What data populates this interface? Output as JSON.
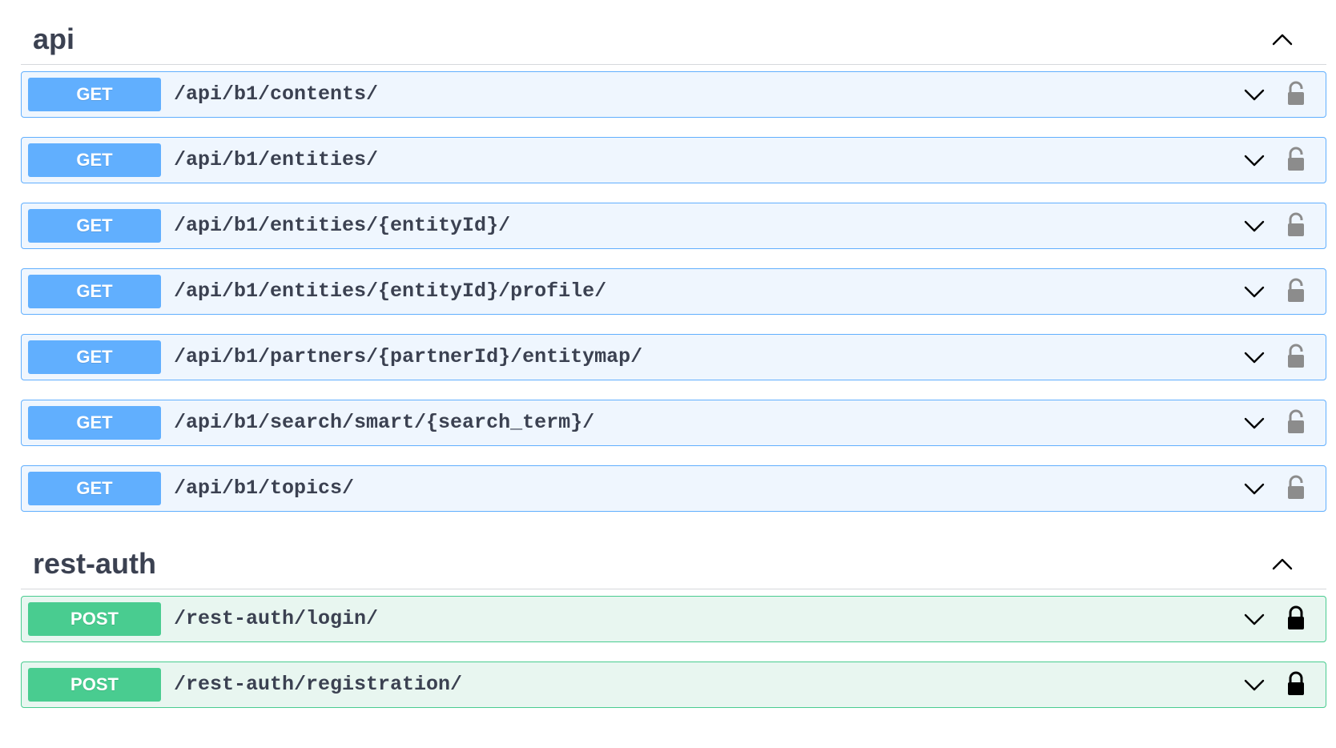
{
  "sections": [
    {
      "title": "api",
      "operations": [
        {
          "method": "GET",
          "path": "/api/b1/contents/",
          "locked": false
        },
        {
          "method": "GET",
          "path": "/api/b1/entities/",
          "locked": false
        },
        {
          "method": "GET",
          "path": "/api/b1/entities/{entityId}/",
          "locked": false
        },
        {
          "method": "GET",
          "path": "/api/b1/entities/{entityId}/profile/",
          "locked": false
        },
        {
          "method": "GET",
          "path": "/api/b1/partners/{partnerId}/entitymap/",
          "locked": false
        },
        {
          "method": "GET",
          "path": "/api/b1/search/smart/{search_term}/",
          "locked": false
        },
        {
          "method": "GET",
          "path": "/api/b1/topics/",
          "locked": false
        }
      ]
    },
    {
      "title": "rest-auth",
      "operations": [
        {
          "method": "POST",
          "path": "/rest-auth/login/",
          "locked": true
        },
        {
          "method": "POST",
          "path": "/rest-auth/registration/",
          "locked": true
        }
      ]
    }
  ],
  "icons": {
    "section_toggle": "chevron-up-icon",
    "operation_toggle": "chevron-down-icon",
    "lock_unlocked": "lock-open-icon",
    "lock_locked": "lock-closed-icon"
  },
  "colors": {
    "get": "#61affe",
    "get_bg": "#eff6fe",
    "post": "#49cc90",
    "post_bg": "#e8f6f0",
    "lock_unlocked": "#8c8c8c",
    "lock_locked": "#000000"
  }
}
